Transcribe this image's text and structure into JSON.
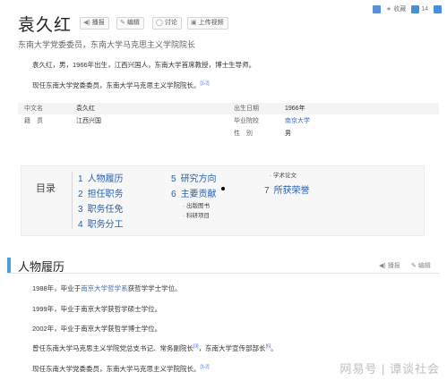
{
  "header": {
    "title": "袁久红",
    "buttons": [
      {
        "label": "播报",
        "icon": "speaker-icon"
      },
      {
        "label": "编辑",
        "icon": "edit-icon"
      },
      {
        "label": "讨论",
        "icon": "chat-icon"
      },
      {
        "label": "上传视频",
        "icon": "video-icon"
      }
    ],
    "collect_label": "收藏",
    "like_count": "14"
  },
  "subtitle": "东南大学党委委员，东南大学马克思主义学院院长",
  "summary": {
    "p1": "袁久红，男，1966年出生，江西兴国人，东南大学首席教授，博士生导师。",
    "p2": "现任东南大学党委委员，东南大学马克思主义学院院长。",
    "p2_ref": "[1-2]"
  },
  "basic_info": {
    "rows": [
      {
        "l1": "中文名",
        "v1": "袁久红",
        "l2": "出生日期",
        "v2": "1966年"
      },
      {
        "l1": "籍　贯",
        "v1": "江西兴国",
        "l2": "毕业院校",
        "v2": "南京大学"
      },
      {
        "l1": "",
        "v1": "",
        "l2": "性　别",
        "v2": "男"
      }
    ]
  },
  "toc": {
    "label": "目录",
    "col1": [
      {
        "num": "1",
        "label": "人物履历"
      },
      {
        "num": "2",
        "label": "担任职务"
      },
      {
        "num": "3",
        "label": "职务任免"
      },
      {
        "num": "4",
        "label": "职务分工"
      }
    ],
    "col2": [
      {
        "num": "5",
        "label": "研究方向"
      },
      {
        "num": "6",
        "label": "主要贡献"
      }
    ],
    "col2_subs": [
      "出版图书",
      "科研项目"
    ],
    "col3_sub": "学术论文",
    "col3": {
      "num": "7",
      "label": "所获荣誉"
    }
  },
  "section": {
    "title": "人物履历",
    "actions": [
      {
        "label": "播报",
        "icon": "speaker-icon"
      },
      {
        "label": "编辑",
        "icon": "edit-icon"
      }
    ],
    "paragraphs": {
      "l1_pre": "1988年，毕业于",
      "l1_link": "南京大学哲学系",
      "l1_post": "获哲学学士学位。",
      "l2": "1999年，毕业于南京大学获哲学硕士学位。",
      "l3": "2002年，毕业于南京大学获哲学博士学位。",
      "l4_a": "曾任东南大学马克思主义学院党总支书记、常务副院长",
      "l4_ref1": "[3]",
      "l4_b": "，东南大学宣传部部长",
      "l4_ref2": "[6]",
      "l4_c": "。",
      "l5": "现任东南大学党委委员，东南大学马克思主义学院院长。",
      "l5_ref": "[1-2]"
    }
  },
  "watermark": "网易号 | 谭谈社会"
}
